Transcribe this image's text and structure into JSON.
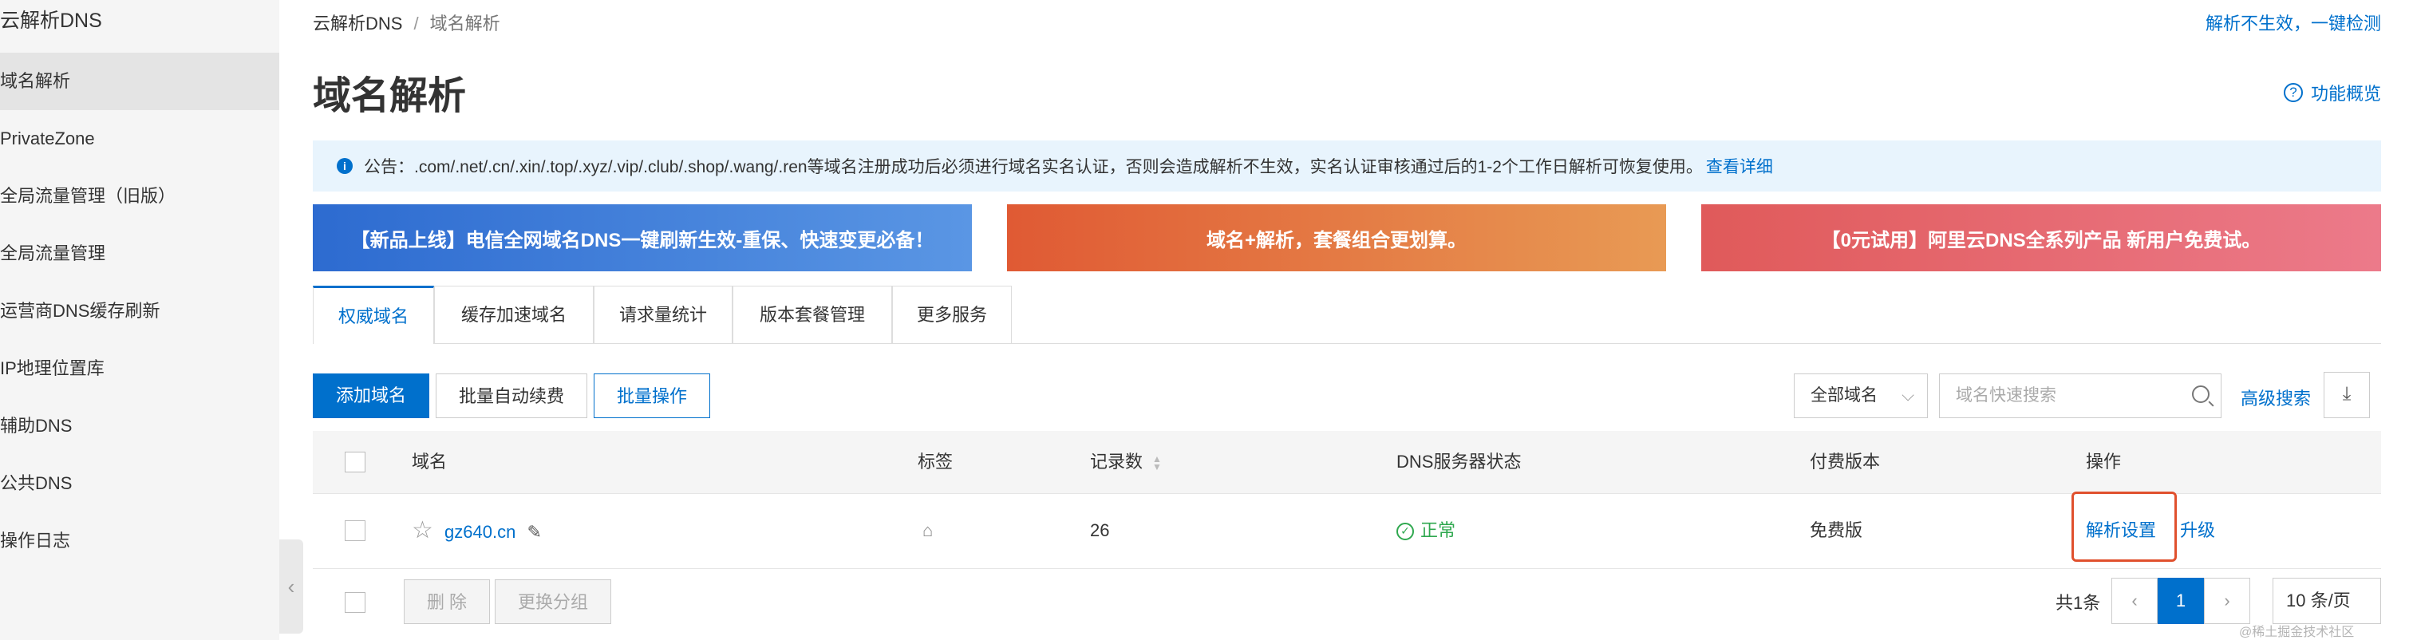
{
  "sidebar": {
    "title": "云解析DNS",
    "items": [
      {
        "label": "域名解析",
        "active": true
      },
      {
        "label": "PrivateZone"
      },
      {
        "label": "全局流量管理（旧版）"
      },
      {
        "label": "全局流量管理"
      },
      {
        "label": "运营商DNS缓存刷新"
      },
      {
        "label": "IP地理位置库"
      },
      {
        "label": "辅助DNS"
      },
      {
        "label": "公共DNS"
      },
      {
        "label": "操作日志"
      }
    ]
  },
  "breadcrumb": {
    "root": "云解析DNS",
    "sep": "/",
    "current": "域名解析"
  },
  "header": {
    "check_link": "解析不生效，一键检测",
    "title": "域名解析",
    "overview_link": "功能概览"
  },
  "notice": {
    "text": "公告：.com/.net/.cn/.xin/.top/.xyz/.vip/.club/.shop/.wang/.ren等域名注册成功后必须进行域名实名认证，否则会造成解析不生效，实名认证审核通过后的1-2个工作日解析可恢复使用。",
    "link": "查看详细"
  },
  "banners": [
    "【新品上线】电信全网域名DNS一键刷新生效-重保、快速变更必备！",
    "域名+解析，套餐组合更划算。",
    "【0元试用】阿里云DNS全系列产品 新用户免费试。"
  ],
  "tabs": [
    "权威域名",
    "缓存加速域名",
    "请求量统计",
    "版本套餐管理",
    "更多服务"
  ],
  "toolbar": {
    "add": "添加域名",
    "auto_renew": "批量自动续费",
    "batch": "批量操作",
    "domain_filter": "全部域名",
    "search_placeholder": "域名快速搜索",
    "advanced_search": "高级搜索"
  },
  "table": {
    "columns": [
      "域名",
      "标签",
      "记录数",
      "DNS服务器状态",
      "付费版本",
      "操作"
    ],
    "rows": [
      {
        "domain": "gz640.cn",
        "records": "26",
        "dns_status": "正常",
        "edition": "免费版",
        "action_primary": "解析设置",
        "action_secondary": "升级"
      }
    ]
  },
  "footer": {
    "delete": "删 除",
    "change_group": "更换分组",
    "total": "共1条",
    "current_page": "1",
    "page_size": "10 条/页"
  },
  "watermark": "@稀土掘金技术社区",
  "colors": {
    "accent": "#0070cc",
    "highlight": "#e0502d",
    "success": "#2fa84f"
  }
}
